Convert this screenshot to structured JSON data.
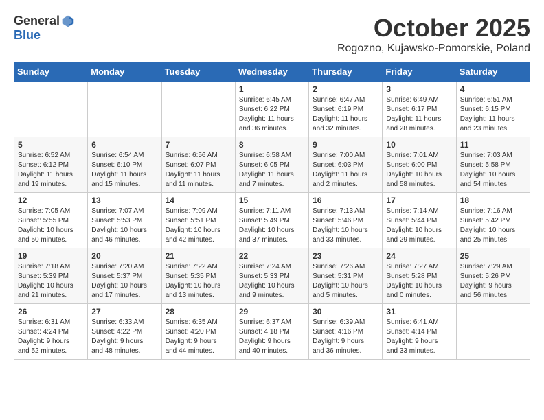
{
  "header": {
    "logo_general": "General",
    "logo_blue": "Blue",
    "month": "October 2025",
    "location": "Rogozno, Kujawsko-Pomorskie, Poland"
  },
  "weekdays": [
    "Sunday",
    "Monday",
    "Tuesday",
    "Wednesday",
    "Thursday",
    "Friday",
    "Saturday"
  ],
  "weeks": [
    [
      {
        "day": "",
        "info": ""
      },
      {
        "day": "",
        "info": ""
      },
      {
        "day": "",
        "info": ""
      },
      {
        "day": "1",
        "info": "Sunrise: 6:45 AM\nSunset: 6:22 PM\nDaylight: 11 hours\nand 36 minutes."
      },
      {
        "day": "2",
        "info": "Sunrise: 6:47 AM\nSunset: 6:19 PM\nDaylight: 11 hours\nand 32 minutes."
      },
      {
        "day": "3",
        "info": "Sunrise: 6:49 AM\nSunset: 6:17 PM\nDaylight: 11 hours\nand 28 minutes."
      },
      {
        "day": "4",
        "info": "Sunrise: 6:51 AM\nSunset: 6:15 PM\nDaylight: 11 hours\nand 23 minutes."
      }
    ],
    [
      {
        "day": "5",
        "info": "Sunrise: 6:52 AM\nSunset: 6:12 PM\nDaylight: 11 hours\nand 19 minutes."
      },
      {
        "day": "6",
        "info": "Sunrise: 6:54 AM\nSunset: 6:10 PM\nDaylight: 11 hours\nand 15 minutes."
      },
      {
        "day": "7",
        "info": "Sunrise: 6:56 AM\nSunset: 6:07 PM\nDaylight: 11 hours\nand 11 minutes."
      },
      {
        "day": "8",
        "info": "Sunrise: 6:58 AM\nSunset: 6:05 PM\nDaylight: 11 hours\nand 7 minutes."
      },
      {
        "day": "9",
        "info": "Sunrise: 7:00 AM\nSunset: 6:03 PM\nDaylight: 11 hours\nand 2 minutes."
      },
      {
        "day": "10",
        "info": "Sunrise: 7:01 AM\nSunset: 6:00 PM\nDaylight: 10 hours\nand 58 minutes."
      },
      {
        "day": "11",
        "info": "Sunrise: 7:03 AM\nSunset: 5:58 PM\nDaylight: 10 hours\nand 54 minutes."
      }
    ],
    [
      {
        "day": "12",
        "info": "Sunrise: 7:05 AM\nSunset: 5:55 PM\nDaylight: 10 hours\nand 50 minutes."
      },
      {
        "day": "13",
        "info": "Sunrise: 7:07 AM\nSunset: 5:53 PM\nDaylight: 10 hours\nand 46 minutes."
      },
      {
        "day": "14",
        "info": "Sunrise: 7:09 AM\nSunset: 5:51 PM\nDaylight: 10 hours\nand 42 minutes."
      },
      {
        "day": "15",
        "info": "Sunrise: 7:11 AM\nSunset: 5:49 PM\nDaylight: 10 hours\nand 37 minutes."
      },
      {
        "day": "16",
        "info": "Sunrise: 7:13 AM\nSunset: 5:46 PM\nDaylight: 10 hours\nand 33 minutes."
      },
      {
        "day": "17",
        "info": "Sunrise: 7:14 AM\nSunset: 5:44 PM\nDaylight: 10 hours\nand 29 minutes."
      },
      {
        "day": "18",
        "info": "Sunrise: 7:16 AM\nSunset: 5:42 PM\nDaylight: 10 hours\nand 25 minutes."
      }
    ],
    [
      {
        "day": "19",
        "info": "Sunrise: 7:18 AM\nSunset: 5:39 PM\nDaylight: 10 hours\nand 21 minutes."
      },
      {
        "day": "20",
        "info": "Sunrise: 7:20 AM\nSunset: 5:37 PM\nDaylight: 10 hours\nand 17 minutes."
      },
      {
        "day": "21",
        "info": "Sunrise: 7:22 AM\nSunset: 5:35 PM\nDaylight: 10 hours\nand 13 minutes."
      },
      {
        "day": "22",
        "info": "Sunrise: 7:24 AM\nSunset: 5:33 PM\nDaylight: 10 hours\nand 9 minutes."
      },
      {
        "day": "23",
        "info": "Sunrise: 7:26 AM\nSunset: 5:31 PM\nDaylight: 10 hours\nand 5 minutes."
      },
      {
        "day": "24",
        "info": "Sunrise: 7:27 AM\nSunset: 5:28 PM\nDaylight: 10 hours\nand 0 minutes."
      },
      {
        "day": "25",
        "info": "Sunrise: 7:29 AM\nSunset: 5:26 PM\nDaylight: 9 hours\nand 56 minutes."
      }
    ],
    [
      {
        "day": "26",
        "info": "Sunrise: 6:31 AM\nSunset: 4:24 PM\nDaylight: 9 hours\nand 52 minutes."
      },
      {
        "day": "27",
        "info": "Sunrise: 6:33 AM\nSunset: 4:22 PM\nDaylight: 9 hours\nand 48 minutes."
      },
      {
        "day": "28",
        "info": "Sunrise: 6:35 AM\nSunset: 4:20 PM\nDaylight: 9 hours\nand 44 minutes."
      },
      {
        "day": "29",
        "info": "Sunrise: 6:37 AM\nSunset: 4:18 PM\nDaylight: 9 hours\nand 40 minutes."
      },
      {
        "day": "30",
        "info": "Sunrise: 6:39 AM\nSunset: 4:16 PM\nDaylight: 9 hours\nand 36 minutes."
      },
      {
        "day": "31",
        "info": "Sunrise: 6:41 AM\nSunset: 4:14 PM\nDaylight: 9 hours\nand 33 minutes."
      },
      {
        "day": "",
        "info": ""
      }
    ]
  ]
}
